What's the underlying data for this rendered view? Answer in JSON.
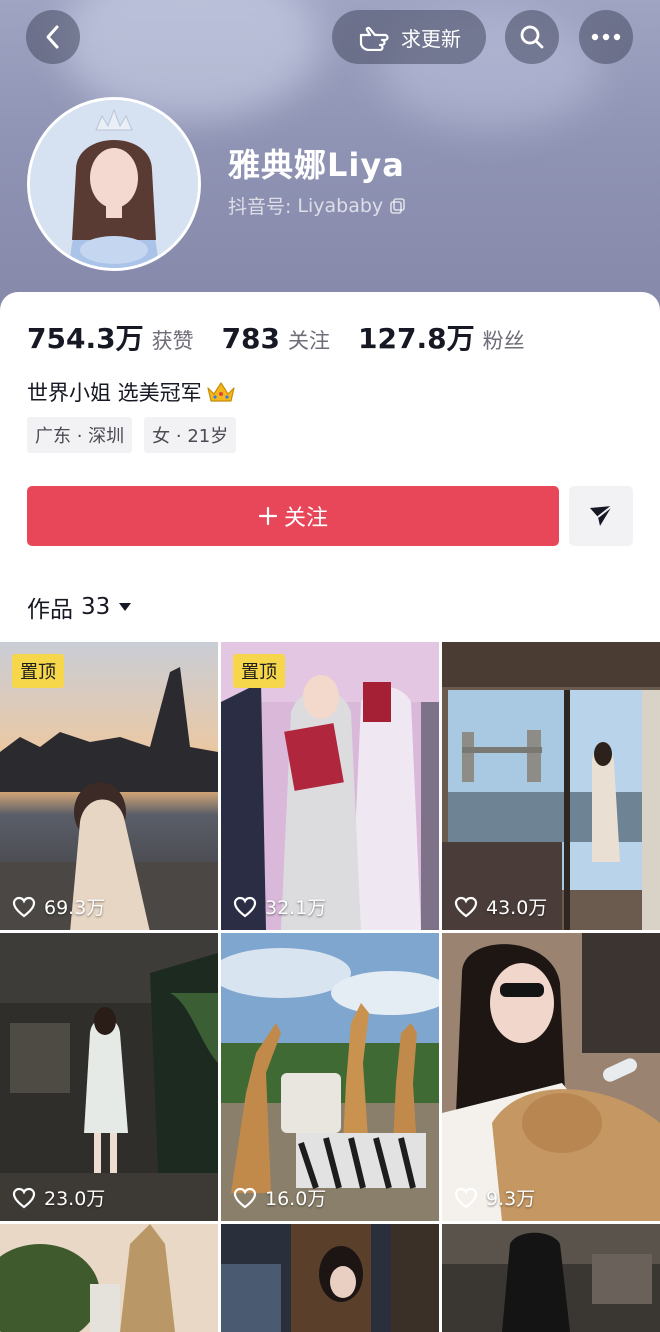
{
  "header": {
    "update_label": "求更新",
    "profile_name": "雅典娜Liya",
    "douyin_id_label": "抖音号:",
    "douyin_id": "Liyababy"
  },
  "stats": [
    {
      "value": "754.3万",
      "label": "获赞"
    },
    {
      "value": "783",
      "label": "关注"
    },
    {
      "value": "127.8万",
      "label": "粉丝"
    }
  ],
  "bio": "世界小姐 选美冠军",
  "tags": [
    "广东 · 深圳",
    "女 · 21岁"
  ],
  "follow_label": "关注",
  "works": {
    "label": "作品",
    "count": "33"
  },
  "videos": [
    {
      "pinned": true,
      "pin_label": "置顶",
      "likes": "69.3万"
    },
    {
      "pinned": true,
      "pin_label": "置顶",
      "likes": "32.1万"
    },
    {
      "pinned": false,
      "likes": "43.0万"
    },
    {
      "pinned": false,
      "likes": "23.0万"
    },
    {
      "pinned": false,
      "likes": "16.0万"
    },
    {
      "pinned": false,
      "likes": "9.3万"
    },
    {
      "pinned": false,
      "likes": ""
    },
    {
      "pinned": false,
      "likes": ""
    },
    {
      "pinned": false,
      "likes": ""
    }
  ],
  "icons": {
    "back": "chevron-left-icon",
    "update": "hand-pointing-icon",
    "search": "search-icon",
    "more": "more-dots-icon",
    "copy": "copy-icon",
    "crown": "crown-emoji",
    "plus": "plus-icon",
    "send": "paper-plane-icon",
    "dropdown": "triangle-down-icon",
    "heart": "heart-outline-icon"
  },
  "colors": {
    "follow_button": "#e8475a",
    "pin_badge": "#f6d64a",
    "banner": "#8f93b4"
  }
}
